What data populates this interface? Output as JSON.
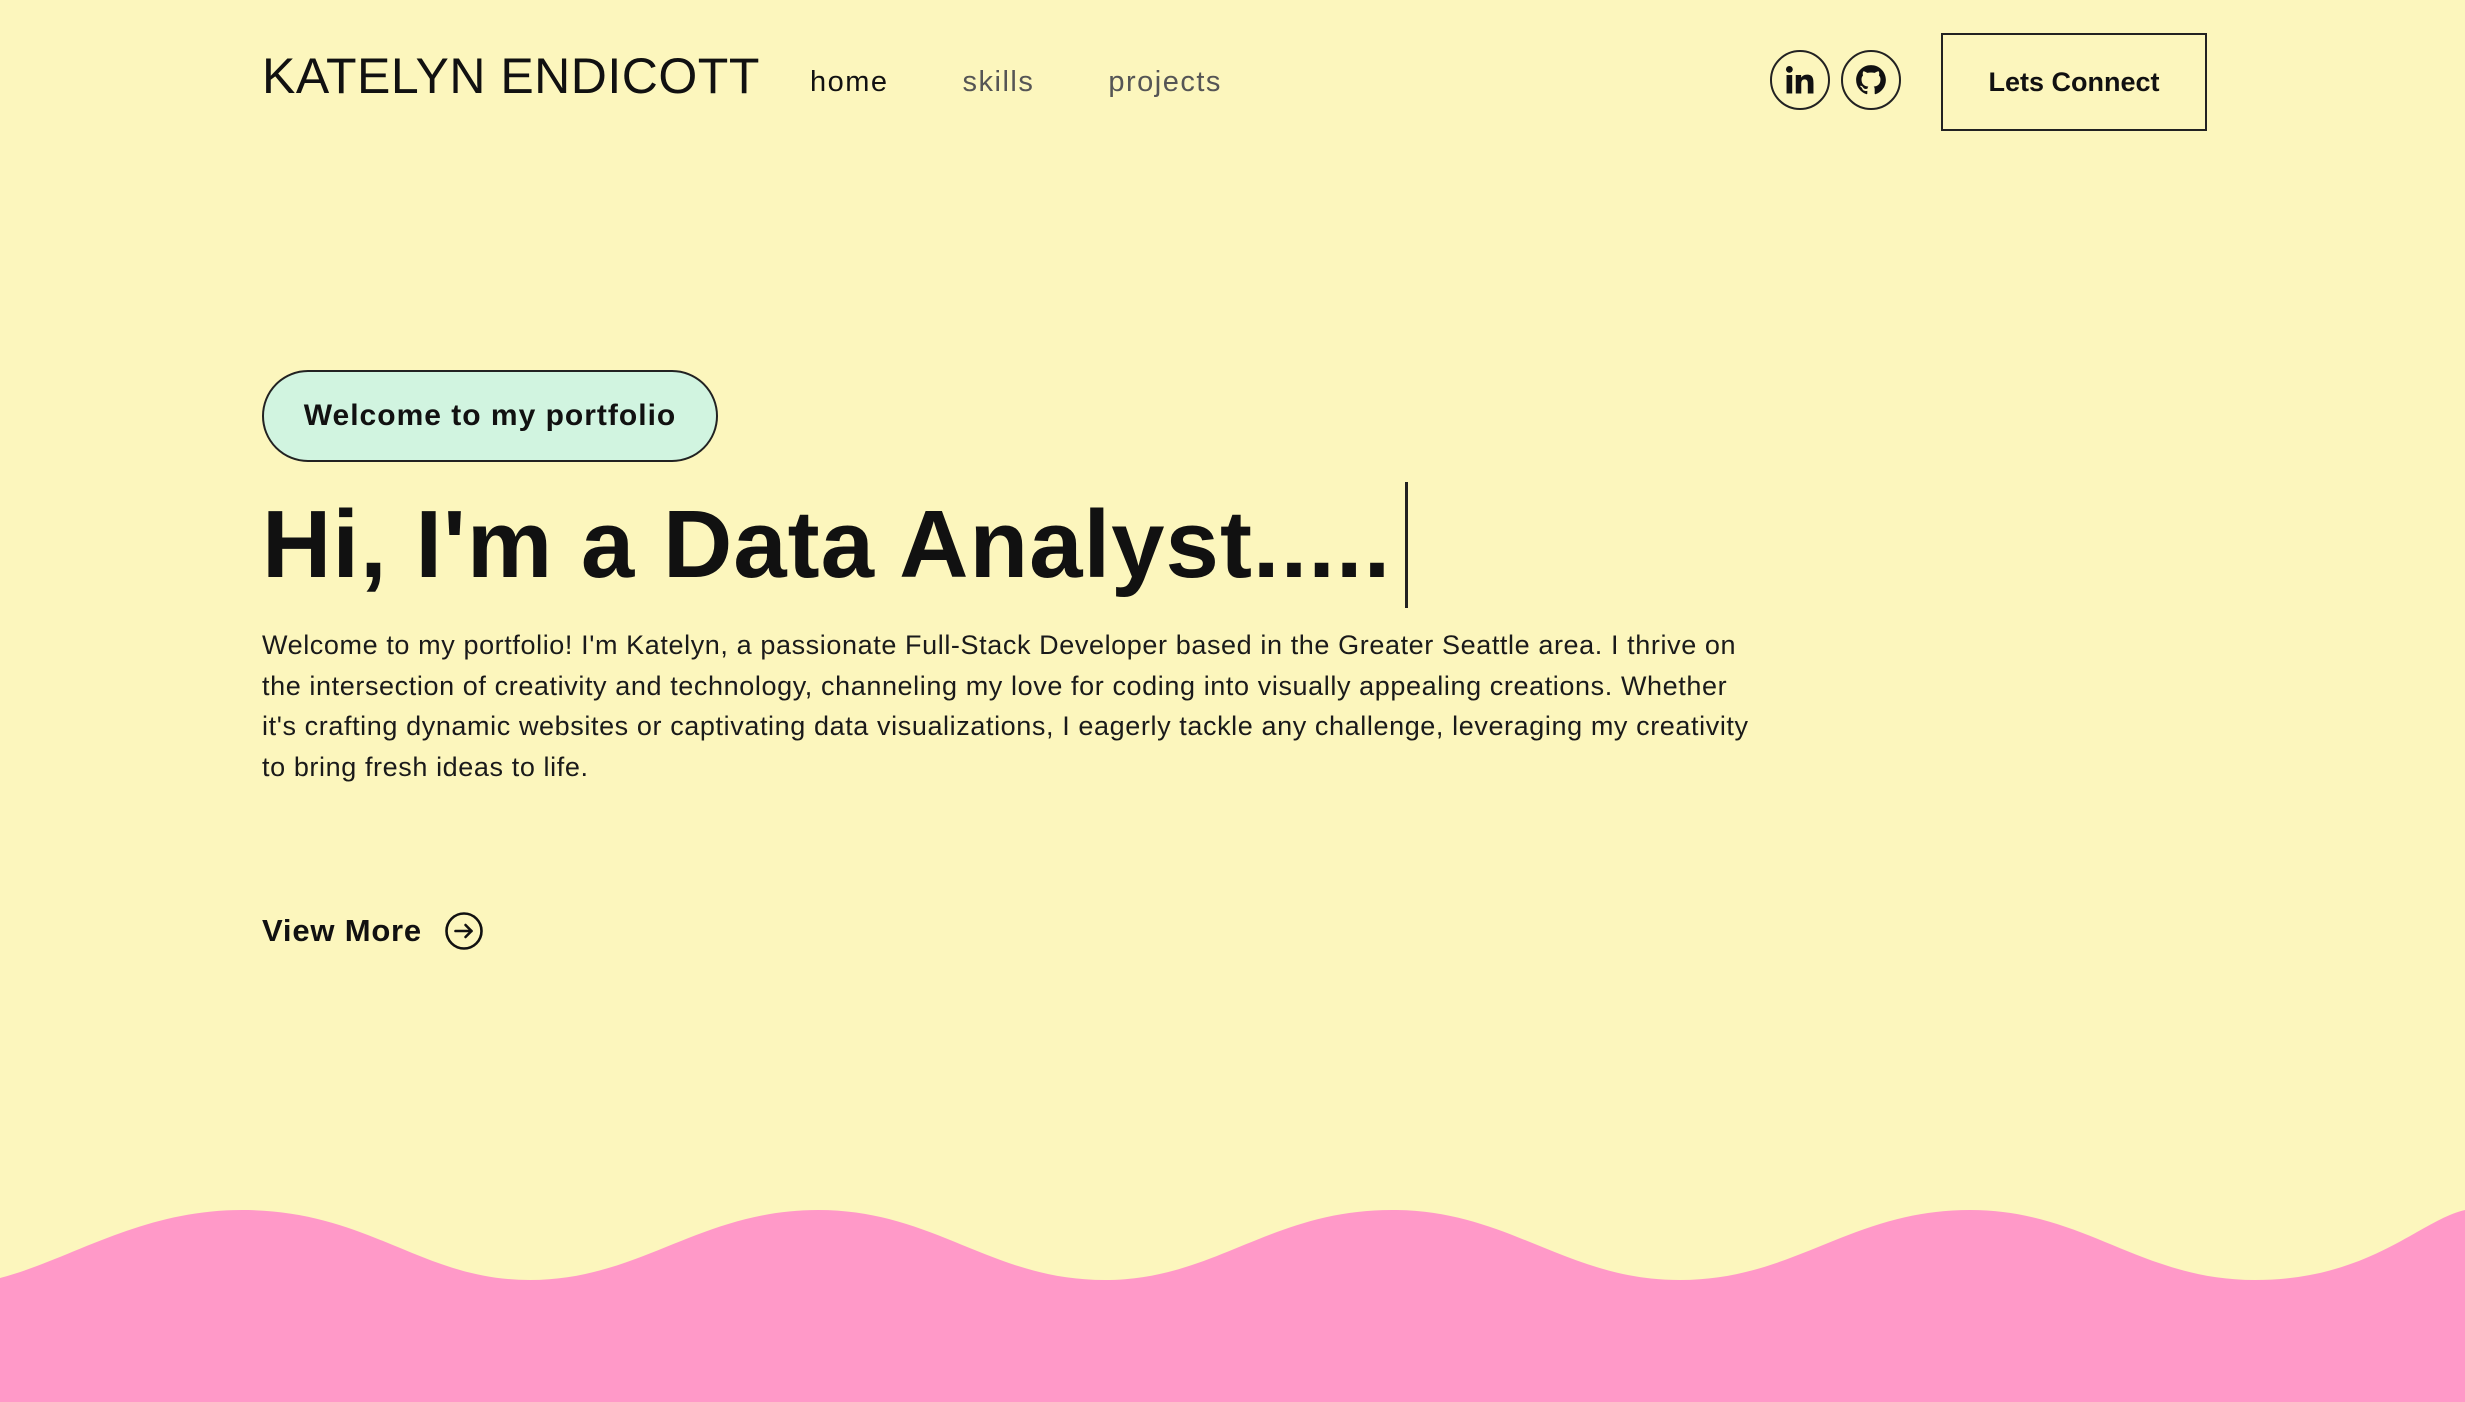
{
  "navbar": {
    "brand": "KATELYN ENDICOTT",
    "links": [
      {
        "label": "home"
      },
      {
        "label": "skills"
      },
      {
        "label": "projects"
      }
    ],
    "social": [
      {
        "icon": "linkedin-icon"
      },
      {
        "icon": "github-icon"
      }
    ],
    "connect_label": "Lets Connect"
  },
  "hero": {
    "tagline": "Welcome to my portfolio",
    "headline": "Hi, I'm a Data Analyst.....",
    "bio": "Welcome to my portfolio! I'm Katelyn, a passionate Full-Stack Developer based in the Greater Seattle area. I thrive on the intersection of creativity and technology, channeling my love for coding into visually appealing creations. Whether it's crafting dynamic websites or captivating data visualizations, I eagerly tackle any challenge, leveraging my creativity to bring fresh ideas to life.",
    "view_more_label": "View More",
    "view_more_icon": "arrow-right-circle-icon"
  },
  "colors": {
    "background": "#fcf6bd",
    "tagline_bg": "#d1f4e0",
    "wave": "#ff99c8",
    "text": "#111111"
  }
}
